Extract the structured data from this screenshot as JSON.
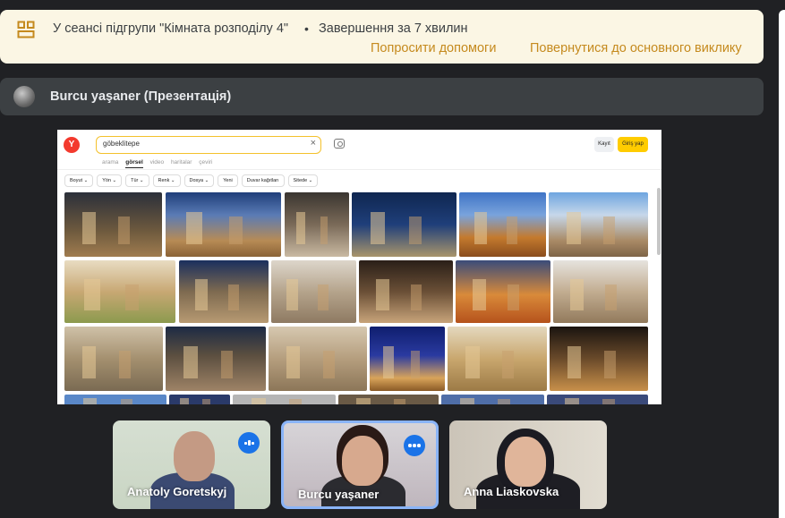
{
  "banner": {
    "session_text": "У сеансі підгрупи \"Кімната розподілу 4\"",
    "separator": "•",
    "timer_text": "Завершення за 7 хвилин",
    "help_link": "Попросити допомоги",
    "return_link": "Повернутися до основного виклику",
    "icon": "breakout-room-icon"
  },
  "presenter": {
    "name": "Burcu yaşaner (Презентація)"
  },
  "shared_screen": {
    "logo_letter": "Y",
    "search_query": "göbeklitepe",
    "tabs": [
      {
        "label": "arama",
        "active": false
      },
      {
        "label": "görsel",
        "active": true
      },
      {
        "label": "video",
        "active": false
      },
      {
        "label": "haritalar",
        "active": false
      },
      {
        "label": "çeviri",
        "active": false
      }
    ],
    "filters": [
      "Boyut ⌄",
      "Yön ⌄",
      "Tür ⌄",
      "Renk ⌄",
      "Dosya ⌄",
      "Yeni",
      "Duvar kağıtları",
      "Sitede ⌄"
    ],
    "kayit_label": "Kayıt",
    "giris_label": "Giriş yap"
  },
  "participants": [
    {
      "name": "Anatoly Goretskyj",
      "indicator": "speaking"
    },
    {
      "name": "Burcu yaşaner",
      "indicator": "more-options"
    },
    {
      "name": "Anna Liaskovska",
      "indicator": "none"
    }
  ],
  "colors": {
    "banner_bg": "#fbf6e4",
    "link": "#c58a1e",
    "presenter_bar": "#3c4043",
    "background": "#202124",
    "accent_blue": "#1a73e8"
  }
}
